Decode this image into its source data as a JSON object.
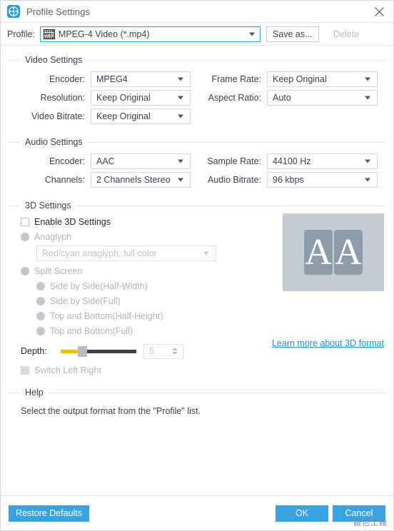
{
  "window": {
    "title": "Profile Settings",
    "app_icon": "film-reel-icon",
    "close_icon": "close-icon"
  },
  "profile_bar": {
    "label": "Profile:",
    "selected": "MPEG-4 Video (*.mp4)",
    "format_icon": "mpeg-film-strip-icon",
    "save_as_label": "Save as...",
    "delete_label": "Delete"
  },
  "video_settings": {
    "title": "Video Settings",
    "fields": [
      {
        "label": "Encoder:",
        "value": "MPEG4"
      },
      {
        "label": "Resolution:",
        "value": "Keep Original"
      },
      {
        "label": "Video Bitrate:",
        "value": "Keep Original"
      },
      {
        "label": "Frame Rate:",
        "value": "Keep Original"
      },
      {
        "label": "Aspect Ratio:",
        "value": "Auto"
      }
    ]
  },
  "audio_settings": {
    "title": "Audio Settings",
    "fields": [
      {
        "label": "Encoder:",
        "value": "AAC"
      },
      {
        "label": "Channels:",
        "value": "2 Channels Stereo"
      },
      {
        "label": "Sample Rate:",
        "value": "44100 Hz"
      },
      {
        "label": "Audio Bitrate:",
        "value": "96 kbps"
      }
    ]
  },
  "three_d_settings": {
    "title": "3D Settings",
    "enable_label": "Enable 3D Settings",
    "anaglyph_label": "Anaglyph",
    "anaglyph_value": "Red/cyan anaglyph, full color",
    "split_screen_label": "Split Screen",
    "split_options": [
      "Side by Side(Half-Width)",
      "Side by Side(Full)",
      "Top and Bottom(Half-Height)",
      "Top and Bottom(Full)"
    ],
    "depth_label": "Depth:",
    "depth_value": "5",
    "switch_left_right_label": "Switch Left Right",
    "learn_more_label": "Learn more about 3D format",
    "preview_left_glyph": "A",
    "preview_right_glyph": "A"
  },
  "help": {
    "title": "Help",
    "text": "Select the output format from the \"Profile\" list."
  },
  "footer": {
    "restore_label": "Restore Defaults",
    "ok_label": "OK",
    "cancel_label": "Cancel"
  },
  "watermark": {
    "text": "銀色工廠"
  },
  "colors": {
    "accent": "#3aa2e0",
    "link": "#1e8fe0",
    "slider_fill": "#f5bc15",
    "preview_bg": "#c3cbd4",
    "preview_pane": "#8e9ba8"
  }
}
